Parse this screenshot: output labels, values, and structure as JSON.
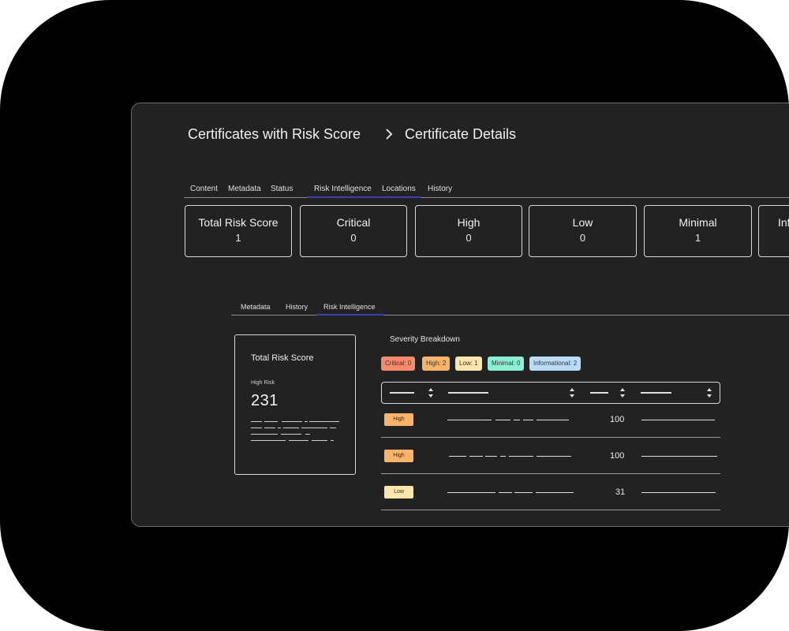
{
  "breadcrumb": {
    "parent": "Certificates with Risk Score",
    "current": "Certificate Details"
  },
  "top_tabs": [
    {
      "label": "Content"
    },
    {
      "label": "Metadata"
    },
    {
      "label": "Status"
    },
    {
      "label": "Risk Intelligence",
      "active": true
    },
    {
      "label": "Locations"
    },
    {
      "label": "History"
    }
  ],
  "summary_cards": [
    {
      "label": "Total Risk Score",
      "value": "1"
    },
    {
      "label": "Critical",
      "value": "0"
    },
    {
      "label": "High",
      "value": "0"
    },
    {
      "label": "Low",
      "value": "0"
    },
    {
      "label": "Minimal",
      "value": "1"
    },
    {
      "label": "Inf",
      "value": ""
    }
  ],
  "inner_tabs": [
    {
      "label": "Metadata"
    },
    {
      "label": "History"
    },
    {
      "label": "Risk Intelligence",
      "active": true
    }
  ],
  "risk_card": {
    "title": "Total Risk Score",
    "subtitle": "High Risk",
    "score": "231"
  },
  "severity": {
    "title": "Severity Breakdown",
    "chips": [
      {
        "label": "Critical: 0",
        "color": "#f58a6f"
      },
      {
        "label": "High: 2",
        "color": "#f9b36a"
      },
      {
        "label": "Low: 1",
        "color": "#fbe6b0"
      },
      {
        "label": "Minimal: 0",
        "color": "#8af0d4"
      },
      {
        "label": "Informational: 2",
        "color": "#b9dcfb"
      }
    ]
  },
  "rows": [
    {
      "severity": "High",
      "score": "100",
      "badge_color": "#f9b36a"
    },
    {
      "severity": "High",
      "score": "100",
      "badge_color": "#f9b36a"
    },
    {
      "severity": "Low",
      "score": "31",
      "badge_color": "#fbe6b0"
    }
  ],
  "colors": {
    "background": "#000000",
    "panel": "#222222",
    "tab_underline": "#3b3fb0"
  }
}
